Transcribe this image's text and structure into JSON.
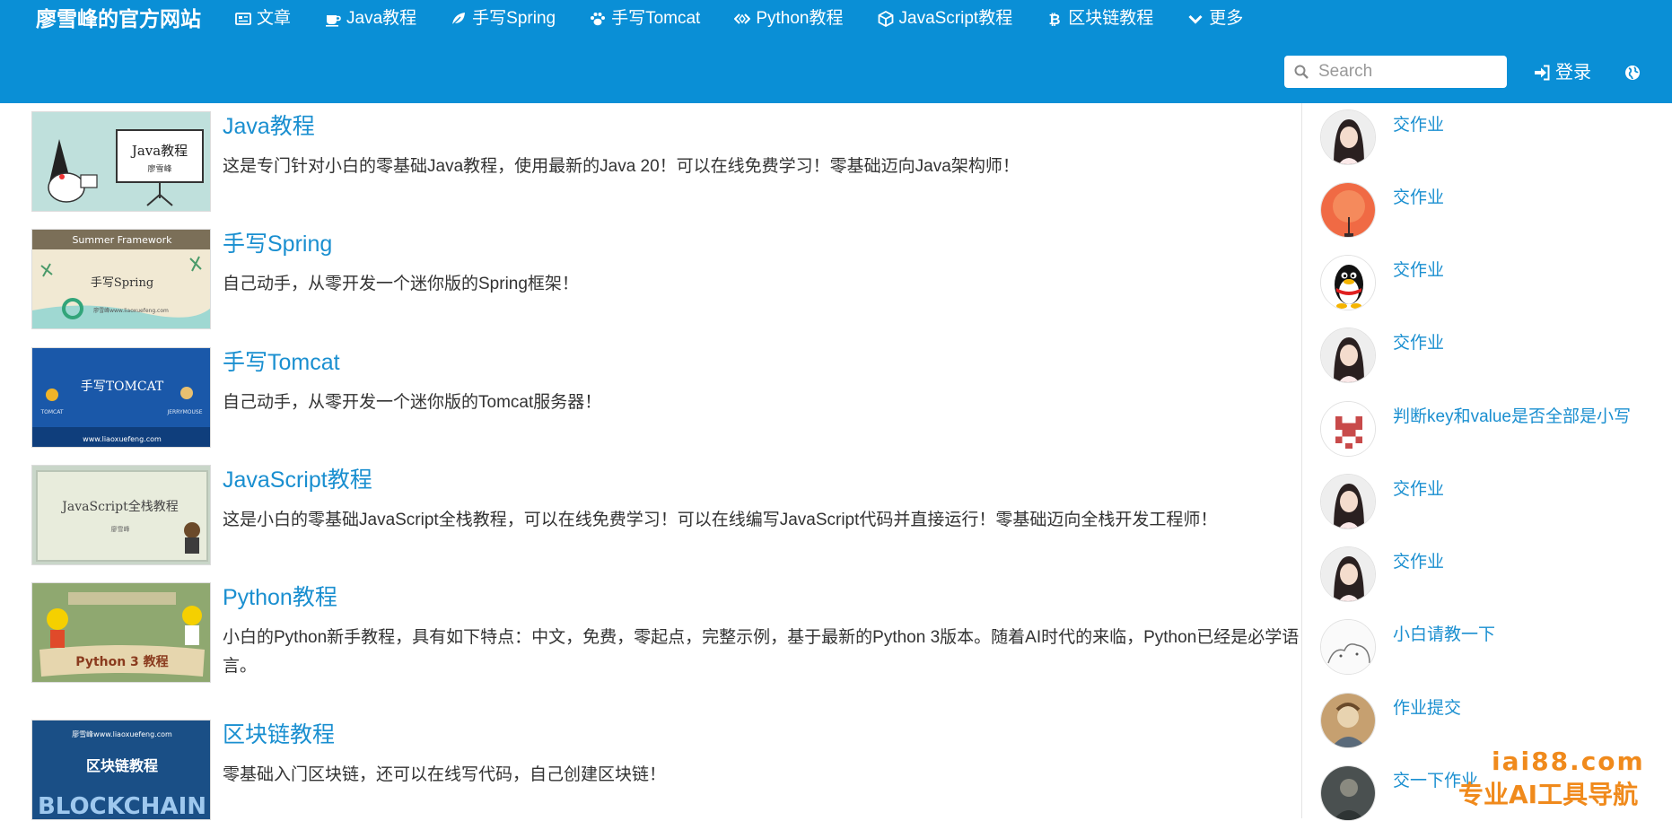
{
  "header": {
    "brand": "廖雪峰的官方网站",
    "nav": [
      {
        "label": "文章",
        "icon": "article-icon"
      },
      {
        "label": "Java教程",
        "icon": "coffee-icon"
      },
      {
        "label": "手写Spring",
        "icon": "leaf-icon"
      },
      {
        "label": "手写Tomcat",
        "icon": "paw-icon"
      },
      {
        "label": "Python教程",
        "icon": "code-icon"
      },
      {
        "label": "JavaScript教程",
        "icon": "cube-icon"
      },
      {
        "label": "区块链教程",
        "icon": "bitcoin-icon"
      },
      {
        "label": "更多",
        "icon": "chevron-down-icon"
      }
    ],
    "search_placeholder": "Search",
    "login_label": "登录",
    "colors": {
      "bar": "#0a8fd6",
      "link": "#1a8fd0"
    }
  },
  "courses": [
    {
      "title": "Java教程",
      "desc": "这是专门针对小白的零基础Java教程，使用最新的Java 20！可以在线免费学习！零基础迈向Java架构师！",
      "thumb_text": [
        "Java教程",
        "廖雪峰"
      ]
    },
    {
      "title": "手写Spring",
      "desc": "自己动手，从零开发一个迷你版的Spring框架！",
      "thumb_text": [
        "Summer Framework",
        "手写Spring",
        "廖雪峰www.liaoxuefeng.com"
      ]
    },
    {
      "title": "手写Tomcat",
      "desc": "自己动手，从零开发一个迷你版的Tomcat服务器！",
      "thumb_text": [
        "手写TOMCAT",
        "TOMCAT",
        "JERRYMOUSE",
        "www.liaoxuefeng.com"
      ]
    },
    {
      "title": "JavaScript教程",
      "desc": "这是小白的零基础JavaScript全栈教程，可以在线免费学习！可以在线编写JavaScript代码并直接运行！零基础迈向全栈开发工程师！",
      "thumb_text": [
        "JavaScript全栈教程",
        "廖雪峰"
      ]
    },
    {
      "title": "Python教程",
      "desc": "小白的Python新手教程，具有如下特点：中文，免费，零起点，完整示例，基于最新的Python 3版本。随着AI时代的来临，Python已经是必学语言。",
      "thumb_text": [
        "Python 3 教程"
      ]
    },
    {
      "title": "区块链教程",
      "desc": "零基础入门区块链，还可以在线写代码，自己创建区块链！",
      "thumb_text": [
        "廖雪峰www.liaoxuefeng.com",
        "区块链教程",
        "BLOCKCHAIN"
      ]
    }
  ],
  "sidebar": {
    "posts": [
      {
        "title": "交作业",
        "avatar": "girl-avatar"
      },
      {
        "title": "交作业",
        "avatar": "sunset-avatar"
      },
      {
        "title": "交作业",
        "avatar": "qq-penguin-avatar"
      },
      {
        "title": "交作业",
        "avatar": "girl-avatar"
      },
      {
        "title": "判断key和value是否全部是小写",
        "avatar": "identicon-avatar"
      },
      {
        "title": "交作业",
        "avatar": "girl-avatar"
      },
      {
        "title": "交作业",
        "avatar": "girl-avatar"
      },
      {
        "title": "小白请教一下",
        "avatar": "sketch-avatar"
      },
      {
        "title": "作业提交",
        "avatar": "painting-avatar"
      },
      {
        "title": "交一下作业",
        "avatar": "photo-avatar"
      }
    ]
  },
  "watermark": {
    "line1": "iai88.com",
    "line2": "专业AI工具导航"
  }
}
